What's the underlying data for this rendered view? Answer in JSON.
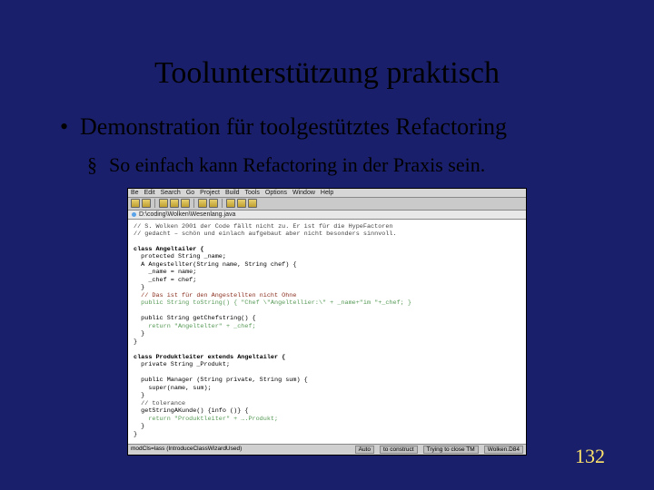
{
  "title": "Toolunterstützung praktisch",
  "bullets": {
    "l1_text": "Demonstration für toolgestütztes Refactoring",
    "l2_text": "So einfach kann Refactoring in der Praxis sein."
  },
  "ide": {
    "menu": [
      "Be",
      "Edit",
      "Search",
      "Go",
      "Project",
      "Build",
      "Tools",
      "Options",
      "Window",
      "Help"
    ],
    "tab": "D:\\coding\\Wolken\\Wesenlang.java",
    "status_left": "modCls=lass (IntroduceClassWizardUsed)",
    "status_right": [
      "Auto",
      "to construct",
      "Trying to close TM",
      "Wolken.D84"
    ],
    "code": [
      "// S. Wolken 2001 der Code fällt nicht zu. Er ist für die HypeFactoren",
      "// gedacht – schön und einlach aufgebaut aber nicht besonders sinnvoll.",
      "",
      "class Angeltailer {",
      "  protected String _name;",
      "  A Angestellter(String name, String chef) {",
      "    _name = name;",
      "    _chef = chef;",
      "  }",
      "  // Das ist für den Angestellten nicht Ohne",
      "  public String toString() { \"Chef \\\"Angeltellier:\\\" + _name+\"im \"+_chef; }",
      "",
      "  public String getChefstring() {",
      "    return \"Angeltelter\" + _chef;",
      "  }",
      "}",
      "",
      "class Produktleiter extends Angeltailer {",
      "  private String _Produkt;",
      "",
      "  public Manager (String private, String sum) {",
      "    super(name, sum);",
      "  }",
      "  // tolerance",
      "  getStringAKunde() {info ()} {",
      "    return \"Produktleiter\" + ….Produkt;",
      "  }",
      "}"
    ]
  },
  "page_number": "132"
}
